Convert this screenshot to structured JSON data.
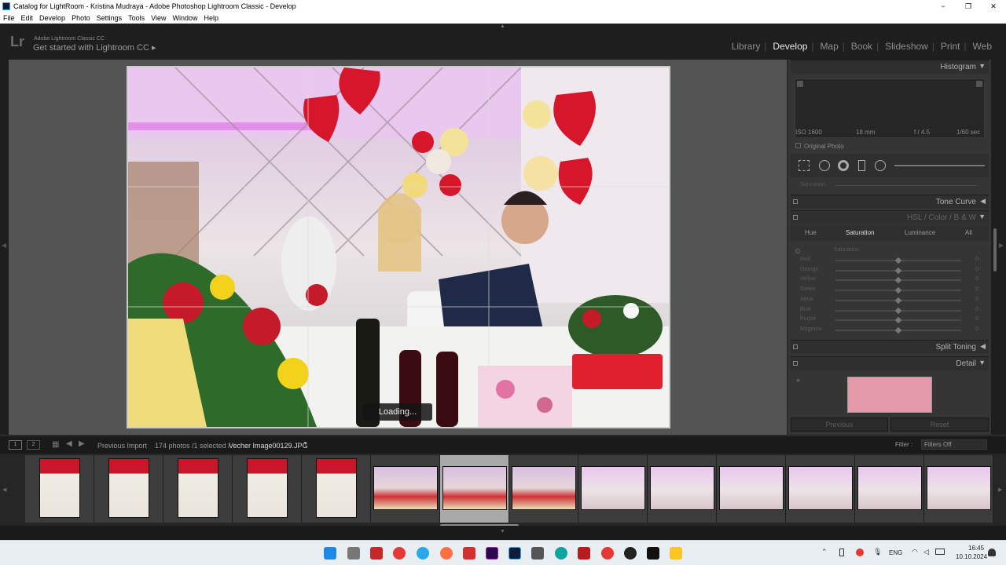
{
  "window": {
    "title": "Catalog for LightRoom - Kristina Mudraya - Adobe Photoshop Lightroom Classic - Develop",
    "minimize": "−",
    "restore": "❐",
    "close": "✕"
  },
  "menu": [
    "File",
    "Edit",
    "Develop",
    "Photo",
    "Settings",
    "Tools",
    "View",
    "Window",
    "Help"
  ],
  "identity": {
    "logo": "Lr",
    "line1": "Adobe Lightroom Classic CC",
    "line2": "Get started with Lightroom CC ▸"
  },
  "modules": [
    "Library",
    "Develop",
    "Map",
    "Book",
    "Slideshow",
    "Print",
    "Web"
  ],
  "active_module": "Develop",
  "photo": {
    "loading": "Loading..."
  },
  "histogram": {
    "title": "Histogram",
    "iso": "ISO 1600",
    "focal": "18 mm",
    "aperture": "f / 4.5",
    "shutter": "1/60 sec",
    "original": "Original Photo"
  },
  "panels": {
    "saturation_stub": "Saturation",
    "tone_curve": "Tone Curve",
    "hsl_title": "HSL / Color / B & W",
    "split_toning": "Split Toning",
    "detail": "Detail"
  },
  "hsl": {
    "tabs": [
      "Hue",
      "Saturation",
      "Luminance",
      "All"
    ],
    "selected_tab": "Saturation",
    "group": "Saturation",
    "sliders": [
      {
        "label": "Red",
        "value": "0"
      },
      {
        "label": "Orange",
        "value": "0"
      },
      {
        "label": "Yellow",
        "value": "0"
      },
      {
        "label": "Green",
        "value": "0"
      },
      {
        "label": "Aqua",
        "value": "0"
      },
      {
        "label": "Blue",
        "value": "0"
      },
      {
        "label": "Purple",
        "value": "0"
      },
      {
        "label": "Magenta",
        "value": "0"
      }
    ]
  },
  "bottom_buttons": {
    "previous": "Previous",
    "reset": "Reset"
  },
  "filmstrip": {
    "view1": "1",
    "view2": "2",
    "source": "Previous Import",
    "count": "174 photos /1 selected /",
    "filename": "Vecher Image00129.JPG",
    "filter_label": "Filter :",
    "filter_value": "Filters Off",
    "selected_index": 6
  },
  "taskbar": {
    "lang": "ENG",
    "time": "16:45",
    "date": "10.10.2024"
  },
  "colors": {
    "accent": "#e8e8e8",
    "lr_blue": "#31a8ff"
  }
}
